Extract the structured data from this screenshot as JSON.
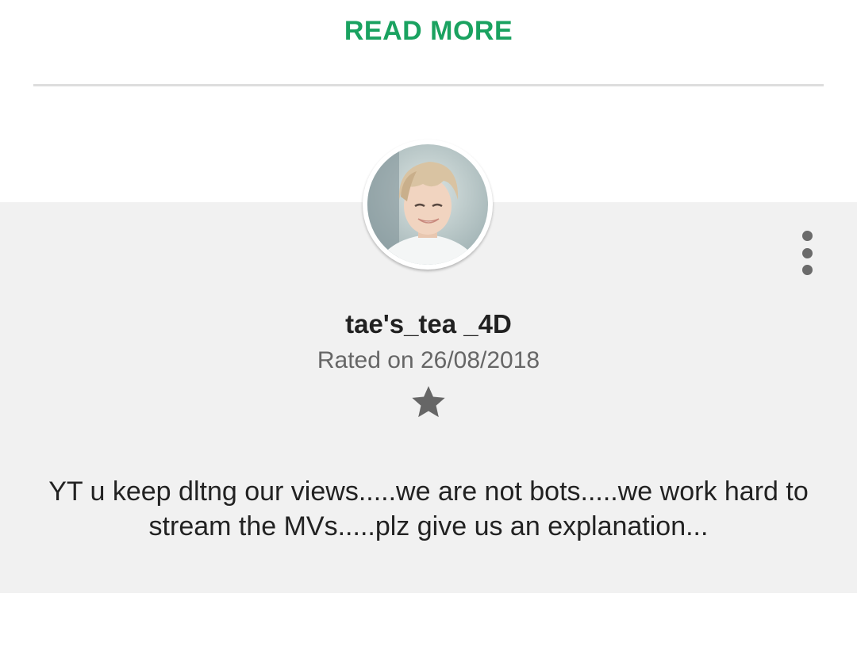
{
  "read_more": {
    "label": "READ MORE",
    "color": "#1aa260"
  },
  "review": {
    "avatar": {
      "description": "user-profile-photo"
    },
    "more_menu_icon": "more-vert-icon",
    "username": "tae's_tea _4D",
    "rated_on": "Rated on 26/08/2018",
    "rating": {
      "stars": 1,
      "icon": "star-icon",
      "color": "#666666"
    },
    "text": "YT u keep dltng our views.....we are not bots.....we work hard to stream the MVs.....plz give us an explanation..."
  },
  "colors": {
    "card_background": "#f1f1f1",
    "divider": "#dddddd"
  }
}
